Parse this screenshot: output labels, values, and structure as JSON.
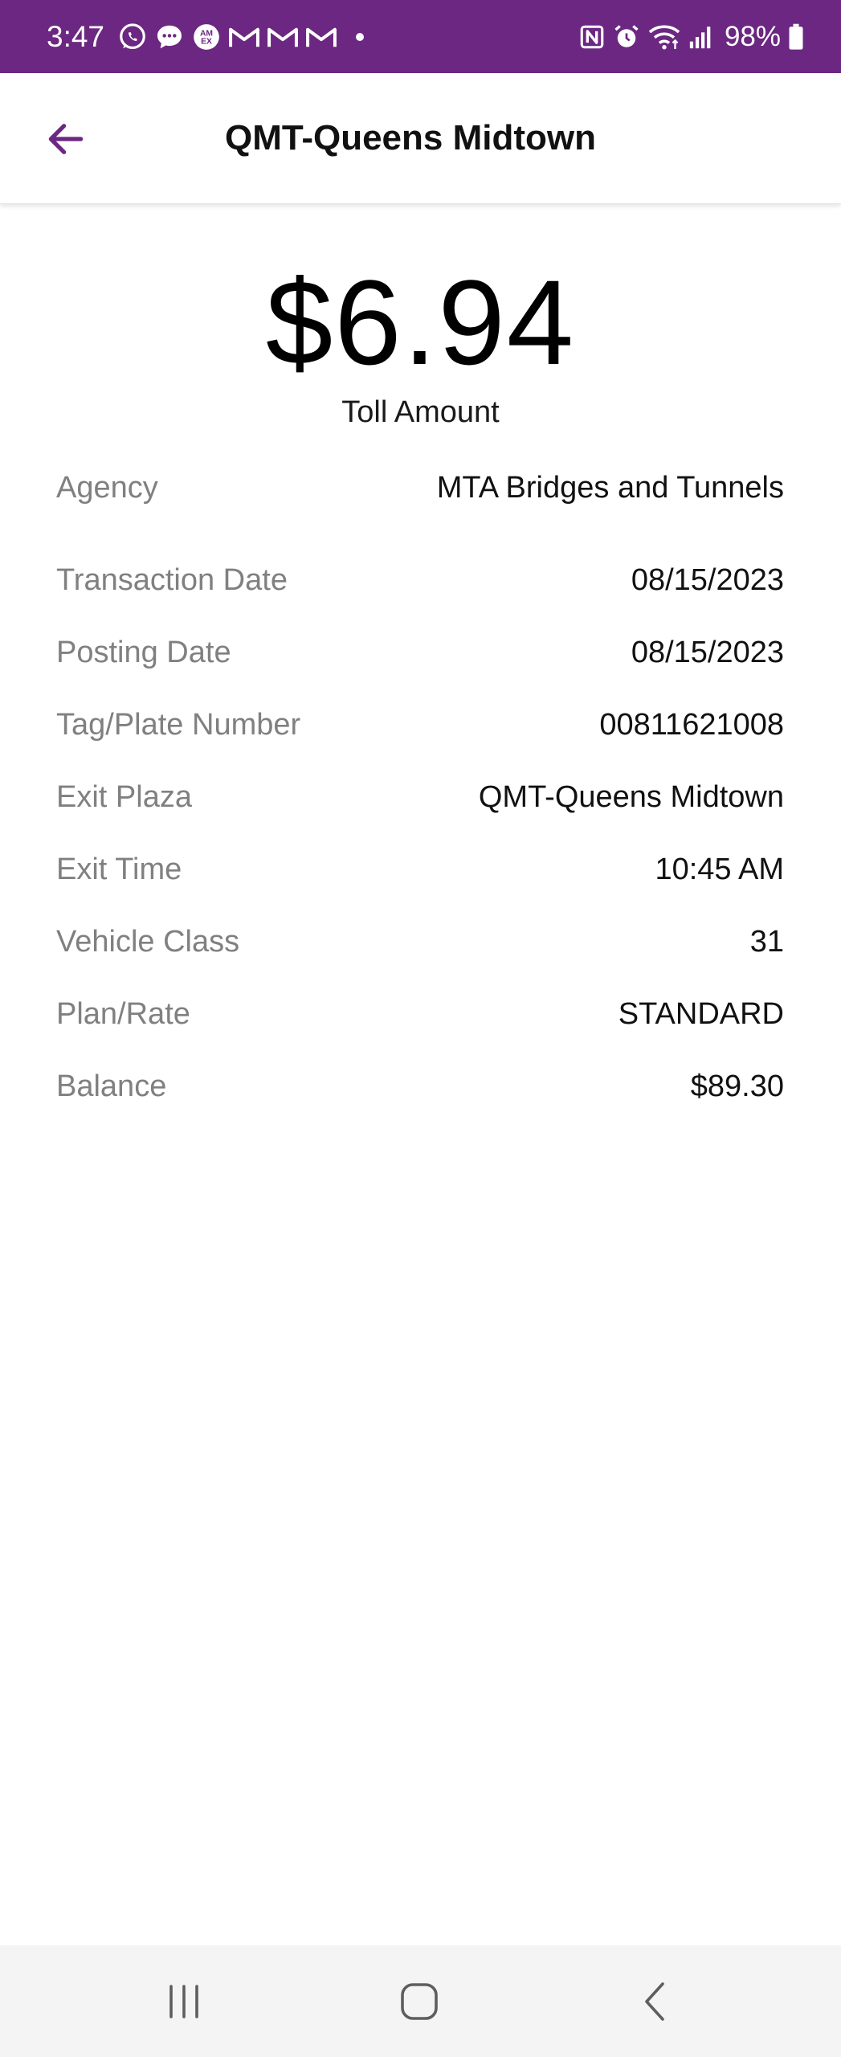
{
  "status_bar": {
    "time": "3:47",
    "battery": "98%",
    "color": "#6b2781",
    "left_icons": [
      "whatsapp-icon",
      "messages-icon",
      "amex-icon",
      "gmail-icon",
      "gmail-icon",
      "gmail-icon",
      "dot-icon"
    ],
    "right_icons": [
      "nfc-icon",
      "alarm-icon",
      "wifi-icon",
      "signal-icon",
      "battery-icon"
    ]
  },
  "app_bar": {
    "back_icon": "arrow-left-icon",
    "title": "QMT-Queens Midtown",
    "accent": "#6b2781"
  },
  "toll": {
    "amount": "$6.94",
    "label": "Toll Amount"
  },
  "details": [
    {
      "label": "Agency",
      "value": "MTA Bridges and Tunnels"
    },
    {
      "label": "Transaction Date",
      "value": "08/15/2023"
    },
    {
      "label": "Posting Date",
      "value": "08/15/2023"
    },
    {
      "label": "Tag/Plate Number",
      "value": "00811621008"
    },
    {
      "label": "Exit Plaza",
      "value": "QMT-Queens Midtown"
    },
    {
      "label": "Exit Time",
      "value": "10:45 AM"
    },
    {
      "label": "Vehicle Class",
      "value": "31"
    },
    {
      "label": "Plan/Rate",
      "value": "STANDARD"
    },
    {
      "label": "Balance",
      "value": "$89.30"
    }
  ],
  "nav_bar": {
    "buttons": [
      "recent-apps-icon",
      "home-icon",
      "back-icon"
    ]
  }
}
